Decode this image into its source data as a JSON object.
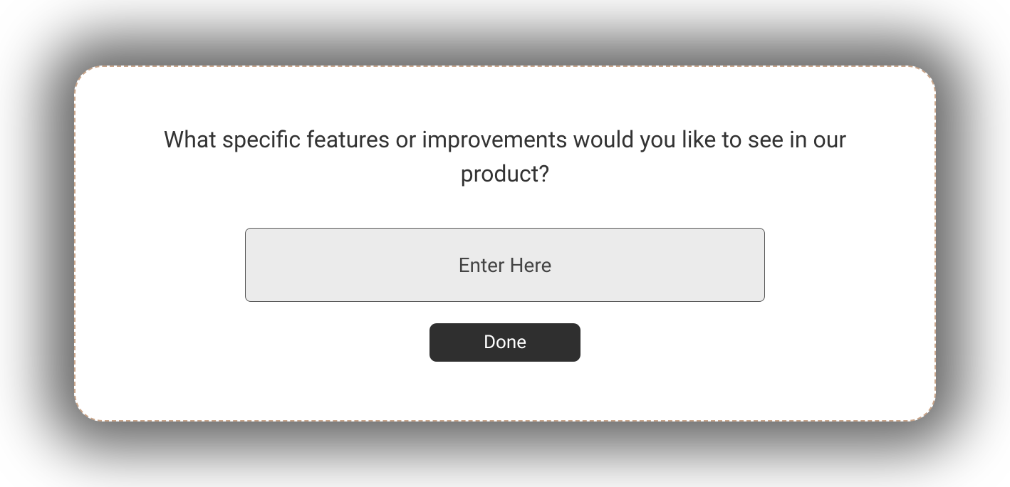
{
  "survey": {
    "question": "What specific features or improvements would you like to see in our product?",
    "input": {
      "placeholder": "Enter Here",
      "value": ""
    },
    "button": {
      "label": "Done"
    }
  }
}
